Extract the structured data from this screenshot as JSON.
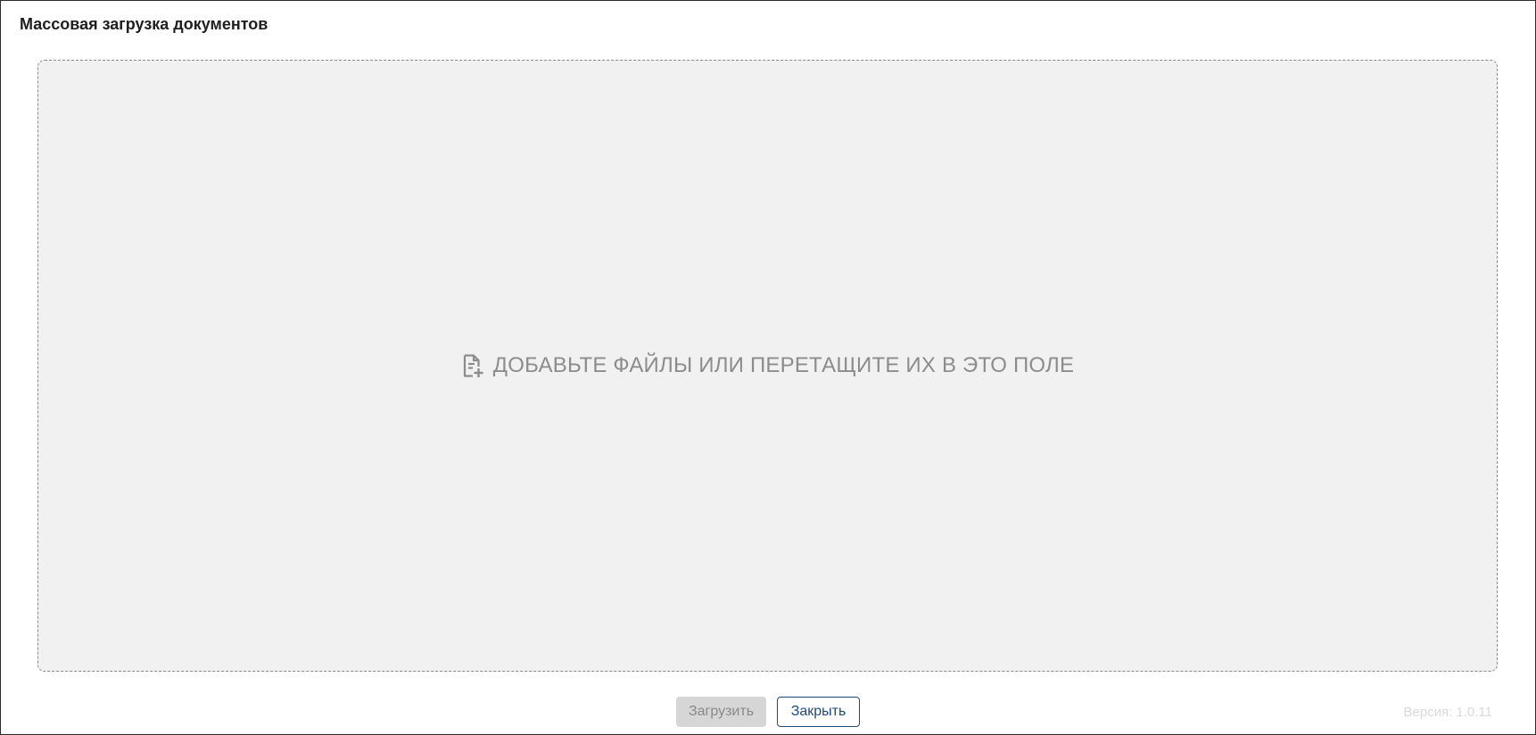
{
  "window": {
    "title": "Массовая загрузка документов"
  },
  "dropzone": {
    "icon": "file-add-icon",
    "text": "ДОБАВЬТЕ ФАЙЛЫ ИЛИ ПЕРЕТАЩИТЕ ИХ В ЭТО ПОЛЕ"
  },
  "footer": {
    "upload_label": "Загрузить",
    "close_label": "Закрыть",
    "version": "Версия: 1.0.11"
  },
  "colors": {
    "accent": "#1f4a7a",
    "dropzone_bg": "#f1f1f1",
    "disabled_button_bg": "#d6d6d6",
    "placeholder_text": "#8c8c8c"
  }
}
